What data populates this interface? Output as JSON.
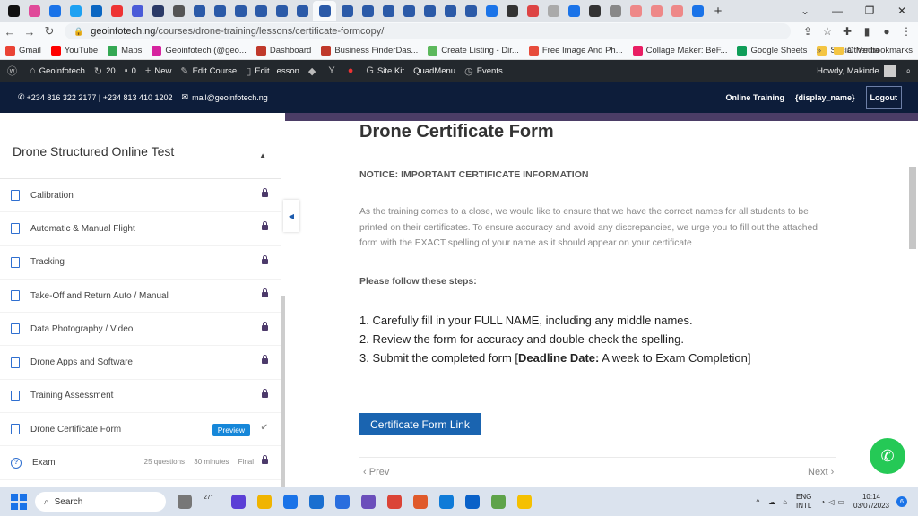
{
  "browser": {
    "url_host": "geoinfotech.ng",
    "url_path": "/courses/drone-training/lessons/certificate-formcopy/",
    "tab_colors": [
      "#111",
      "#e04a9a",
      "#1a73e8",
      "#1da1f2",
      "#0a66c2",
      "#e33",
      "#4a5bd8",
      "#2b3a67",
      "#555",
      "#2b5aa8",
      "#2b5aa8",
      "#2b5aa8",
      "#2b5aa8",
      "#2b5aa8",
      "#2b5aa8",
      "#2b5aa8",
      "#2b5aa8",
      "#2b5aa8",
      "#2b5aa8",
      "#2b5aa8",
      "#2b5aa8",
      "#2b5aa8",
      "#2b5aa8",
      "#1a73e8",
      "#333",
      "#d44",
      "#aaa",
      "#1a73e8",
      "#333",
      "#888",
      "#e88",
      "#e88",
      "#e88",
      "#1a73e8"
    ],
    "bookmarks": [
      {
        "label": "Gmail",
        "color": "#ea4335"
      },
      {
        "label": "YouTube",
        "color": "#ff0000"
      },
      {
        "label": "Maps",
        "color": "#34a853"
      },
      {
        "label": "Geoinfotech (@geo...",
        "color": "#d6249f"
      },
      {
        "label": "Dashboard",
        "color": "#c0392b"
      },
      {
        "label": "Business FinderDas...",
        "color": "#c0392b"
      },
      {
        "label": "Create Listing - Dir...",
        "color": "#5cb85c"
      },
      {
        "label": "Free Image And Ph...",
        "color": "#e74c3c"
      },
      {
        "label": "Collage Maker: BeF...",
        "color": "#e91e63"
      },
      {
        "label": "Google Sheets",
        "color": "#0f9d58"
      },
      {
        "label": "Social Media",
        "color": "#f4c542"
      }
    ],
    "other_bookmarks": "Other bookmarks"
  },
  "wp_admin": {
    "site": "Geoinfotech",
    "updates": "20",
    "comments": "0",
    "new": "New",
    "edit_course": "Edit Course",
    "edit_lesson": "Edit Lesson",
    "site_kit": "Site Kit",
    "quadmenu": "QuadMenu",
    "events": "Events",
    "howdy": "Howdy, Makinde"
  },
  "topinfo": {
    "phone": "+234 816 322 2177 | +234 813 410 1202",
    "email": "mail@geoinfotech.ng",
    "online_training": "Online Training",
    "display_name": "{display_name}",
    "logout": "Logout"
  },
  "sidebar": {
    "title": "Drone Structured Online Test",
    "items": [
      {
        "label": "Calibration"
      },
      {
        "label": "Automatic & Manual Flight"
      },
      {
        "label": "Tracking"
      },
      {
        "label": "Take-Off and Return Auto / Manual"
      },
      {
        "label": "Data Photography / Video"
      },
      {
        "label": "Drone Apps and Software"
      },
      {
        "label": "Training Assessment"
      }
    ],
    "current": {
      "label": "Drone Certificate Form",
      "badge": "Preview"
    },
    "exam": {
      "label": "Exam",
      "questions": "25 questions",
      "duration": "30 minutes",
      "type": "Final"
    }
  },
  "content": {
    "title": "Drone Certificate Form",
    "notice": "NOTICE: IMPORTANT CERTIFICATE INFORMATION",
    "paragraph": "As the training comes to a close, we would like to ensure that we have the correct names for all students to be printed on their certificates. To ensure accuracy and avoid any discrepancies, we urge you to fill out the attached form with the EXACT spelling of your name as it should appear on your certificate",
    "steps_heading": "Please follow these steps:",
    "step1": "1. Carefully fill in your FULL NAME, including any middle names.",
    "step2": "2. Review the form for accuracy and double-check the spelling.",
    "step3_prefix": "3. Submit the completed form [",
    "step3_bold": "Deadline Date:",
    "step3_suffix": " A week to Exam Completion]",
    "button": "Certificate Form Link",
    "prev": "Prev",
    "next": "Next"
  },
  "taskbar": {
    "search": "Search",
    "lang1": "ENG",
    "lang2": "INTL",
    "time": "10:14",
    "date": "03/07/2023",
    "weather": "27°",
    "notif": "6",
    "app_colors": [
      "#777",
      "#f5a623",
      "#5b3fd6",
      "#f0b400",
      "#1a73e8",
      "#1a6fd0",
      "#2a6ede",
      "#6b4fbb",
      "#db4437",
      "#e05a2b",
      "#0f7bd8",
      "#0a61c8",
      "#5ea34a",
      "#f5c000"
    ]
  }
}
